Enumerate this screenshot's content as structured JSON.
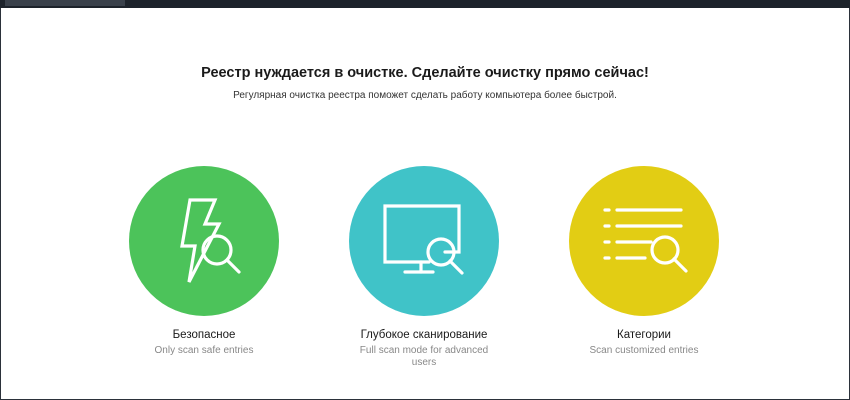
{
  "main": {
    "headline": "Реестр нуждается в очистке. Сделайте очистку прямо сейчас!",
    "subline": "Регулярная очистка реестра поможет сделать работу компьютера более быстрой."
  },
  "options": [
    {
      "title": "Безопасное",
      "description": "Only scan safe entries",
      "color": "#4cc35a",
      "icon": "lightning-magnifier-icon"
    },
    {
      "title": "Глубокое сканирование",
      "description": "Full scan mode for advanced users",
      "color": "#40c3c8",
      "icon": "monitor-magnifier-icon"
    },
    {
      "title": "Категории",
      "description": "Scan customized entries",
      "color": "#e2cd14",
      "icon": "list-magnifier-icon"
    }
  ],
  "colors": {
    "titlebar": "#1d232b",
    "background": "#ffffff",
    "title_text": "#1a1a1a",
    "desc_text": "#888888"
  }
}
